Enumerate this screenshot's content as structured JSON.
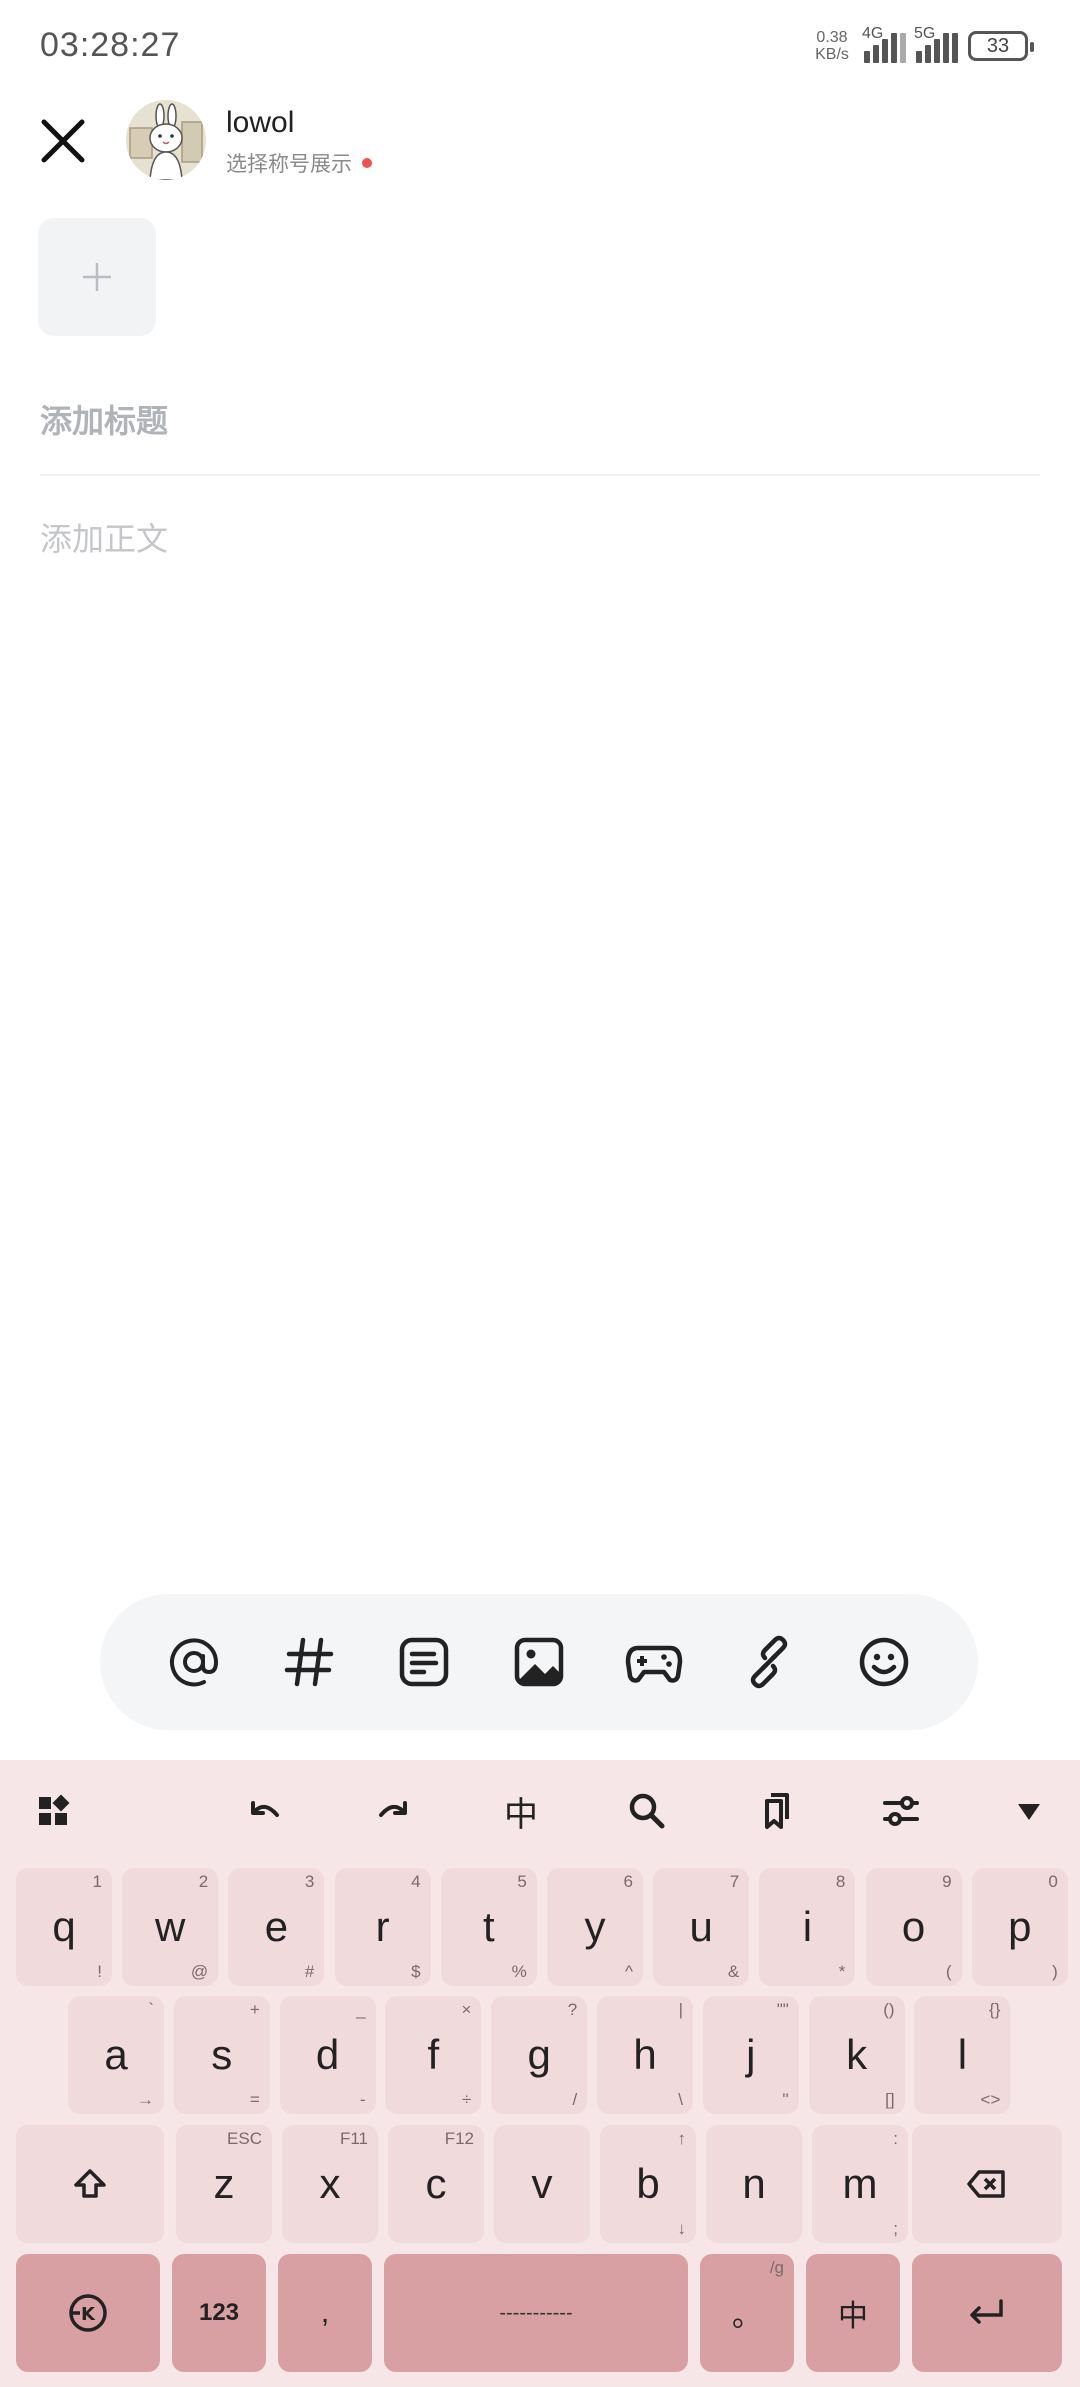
{
  "status_bar": {
    "time": "03:28:27",
    "net_speed_value": "0.38",
    "net_speed_unit": "KB/s",
    "sim1_tag": "4G",
    "sim2_tag": "5G",
    "battery": "33"
  },
  "header": {
    "user_name": "lowol",
    "identity_hint": "选择称号展示"
  },
  "editor": {
    "title_placeholder": "添加标题",
    "body_placeholder": "添加正文"
  },
  "toolbar": {
    "items": [
      "mention-icon",
      "hashtag-icon",
      "template-icon",
      "image-icon",
      "game-icon",
      "link-icon",
      "emoji-icon"
    ]
  },
  "keyboard": {
    "top_bar": {
      "lang_label": "中"
    },
    "row1": [
      {
        "k": "q",
        "tr": "1",
        "br": "!"
      },
      {
        "k": "w",
        "tr": "2",
        "br": "@"
      },
      {
        "k": "e",
        "tr": "3",
        "br": "#"
      },
      {
        "k": "r",
        "tr": "4",
        "br": "$"
      },
      {
        "k": "t",
        "tr": "5",
        "br": "%"
      },
      {
        "k": "y",
        "tr": "6",
        "br": "^"
      },
      {
        "k": "u",
        "tr": "7",
        "br": "&"
      },
      {
        "k": "i",
        "tr": "8",
        "br": "*"
      },
      {
        "k": "o",
        "tr": "9",
        "br": "("
      },
      {
        "k": "p",
        "tr": "0",
        "br": ")"
      }
    ],
    "row2": [
      {
        "k": "a",
        "tr": "`",
        "br": "→"
      },
      {
        "k": "s",
        "tr": "+",
        "br": "="
      },
      {
        "k": "d",
        "tr": "_",
        "br": "-"
      },
      {
        "k": "f",
        "tr": "×",
        "br": "÷"
      },
      {
        "k": "g",
        "tr": "?",
        "br": "/"
      },
      {
        "k": "h",
        "tr": "|",
        "br": "\\"
      },
      {
        "k": "j",
        "tr": "\"\"",
        "br": "''"
      },
      {
        "k": "k",
        "tr": "()",
        "br": "[]"
      },
      {
        "k": "l",
        "tr": "{}",
        "br": "<>"
      }
    ],
    "row3": [
      {
        "k": "z",
        "tr": "ESC",
        "br": ""
      },
      {
        "k": "x",
        "tr": "F11",
        "br": ""
      },
      {
        "k": "c",
        "tr": "F12",
        "br": ""
      },
      {
        "k": "v",
        "tr": "",
        "br": ""
      },
      {
        "k": "b",
        "tr": "↑",
        "br": "↓"
      },
      {
        "k": "n",
        "tr": "",
        "br": ""
      },
      {
        "k": "m",
        "tr": ":",
        "br": ";"
      }
    ],
    "bottom": {
      "num_label": "123",
      "comma_label": ",",
      "space_label": "-----------",
      "period_label": "。",
      "period_alt": "/g",
      "lang_label": "中"
    }
  }
}
